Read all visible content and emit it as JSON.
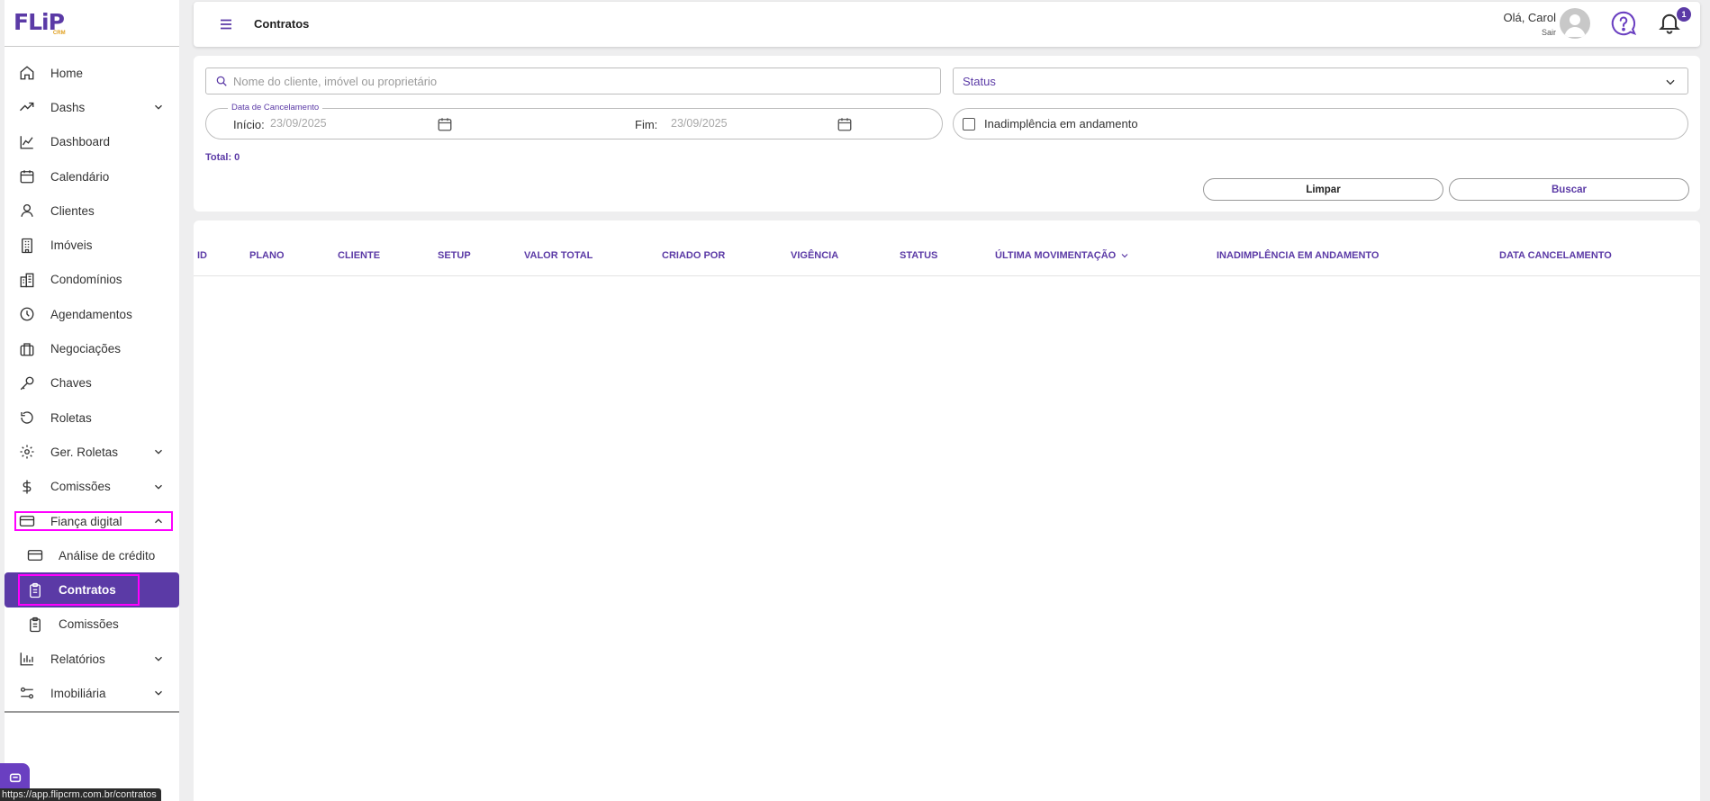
{
  "app": {
    "logo_text": "FLiP",
    "logo_sub": "CRM"
  },
  "sidebar": {
    "items": [
      {
        "label": "Home",
        "icon": "home-icon"
      },
      {
        "label": "Dashs",
        "icon": "trending-up-icon",
        "expandable": true
      },
      {
        "label": "Dashboard",
        "icon": "line-chart-icon"
      },
      {
        "label": "Calendário",
        "icon": "calendar-icon"
      },
      {
        "label": "Clientes",
        "icon": "user-icon"
      },
      {
        "label": "Imóveis",
        "icon": "building-icon"
      },
      {
        "label": "Condomínios",
        "icon": "buildings-icon"
      },
      {
        "label": "Agendamentos",
        "icon": "clock-icon"
      },
      {
        "label": "Negociações",
        "icon": "briefcase-icon"
      },
      {
        "label": "Chaves",
        "icon": "key-icon"
      },
      {
        "label": "Roletas",
        "icon": "rotate-icon"
      },
      {
        "label": "Ger. Roletas",
        "icon": "gear-icon",
        "expandable": true
      },
      {
        "label": "Comissões",
        "icon": "dollar-icon",
        "expandable": true
      },
      {
        "label": "Fiança digital",
        "icon": "credit-card-icon",
        "expandable": true,
        "expanded": true
      },
      {
        "label": "Análise de crédito",
        "icon": "credit-card-icon",
        "sub": true
      },
      {
        "label": "Contratos",
        "icon": "clipboard-icon",
        "sub": true,
        "active": true
      },
      {
        "label": "Comissões",
        "icon": "clipboard-icon",
        "sub": true
      },
      {
        "label": "Relatórios",
        "icon": "bar-chart-icon",
        "expandable": true
      },
      {
        "label": "Imobiliária",
        "icon": "sliders-icon",
        "expandable": true
      }
    ]
  },
  "status_bar": {
    "url": "https://app.flipcrm.com.br/contratos"
  },
  "header": {
    "title": "Contratos",
    "greeting": "Olá, Carol",
    "logout": "Sair",
    "notification_count": "1"
  },
  "filters": {
    "search_placeholder": "Nome do cliente, imóvel ou proprietário",
    "status_label": "Status",
    "date_legend": "Data de Cancelamento",
    "start_label": "Início:",
    "start_value": "23/09/2025",
    "end_label": "Fim:",
    "end_value": "23/09/2025",
    "default_checkbox_label": "Inadimplência em andamento",
    "default_checked": false,
    "total": "Total: 0",
    "clear_label": "Limpar",
    "search_label": "Buscar"
  },
  "table": {
    "columns": [
      "ID",
      "PLANO",
      "CLIENTE",
      "SETUP",
      "VALOR TOTAL",
      "CRIADO POR",
      "VIGÊNCIA",
      "STATUS",
      "ÚLTIMA MOVIMENTAÇÃO",
      "INADIMPLÊNCIA EM ANDAMENTO",
      "DATA CANCELAMENTO"
    ],
    "sorted_column": "ÚLTIMA MOVIMENTAÇÃO",
    "rows": []
  },
  "colors": {
    "accent": "#5b3aa6",
    "highlight": "#ff00ff"
  }
}
